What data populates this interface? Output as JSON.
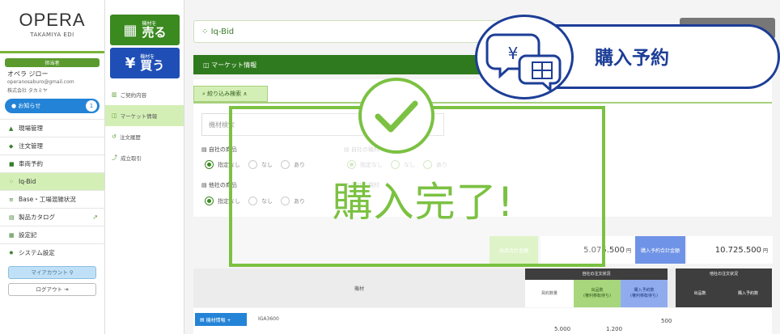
{
  "brand": {
    "name": "OPERA",
    "sub": "TAKAMIYA EDI"
  },
  "user": {
    "role": "担当者",
    "name": "オペラ ジロー",
    "email": "operanosaburo@gmail.com",
    "company": "株式会社 タカミヤ"
  },
  "notice": {
    "label": "● お知らせ",
    "count": "1"
  },
  "nav": [
    {
      "label": "現場管理"
    },
    {
      "label": "注文管理"
    },
    {
      "label": "車両予約"
    },
    {
      "label": "Iq-Bid"
    },
    {
      "label": "Base・工場混雑状況"
    },
    {
      "label": "製品カタログ"
    },
    {
      "label": "設定記"
    },
    {
      "label": "システム設定"
    }
  ],
  "account": {
    "myaccount": "マイアカウント",
    "logout": "ログアウト"
  },
  "trade": {
    "sell_small": "機材を",
    "sell_large": "売る",
    "buy_small": "機材を",
    "buy_large": "買う"
  },
  "sub_nav": [
    {
      "label": "ご契約内容"
    },
    {
      "label": "マーケット情報"
    },
    {
      "label": "注文履歴"
    },
    {
      "label": "成立取引"
    }
  ],
  "page": {
    "title": "Iq-Bid",
    "market_title": "マーケット情報"
  },
  "search": {
    "toggle_label": "絞り込み検索",
    "keyword_placeholder": "機材検索",
    "group1_label": "自社の商品",
    "group1_faded_label": "自社の機材",
    "group2_label": "他社の商品",
    "group2_faded_label": "他社の機材",
    "opt_none_specified": "指定なし",
    "opt_no": "なし",
    "opt_yes": "あり"
  },
  "summary": {
    "label1": "出品合計金額",
    "value1": "5.075.500",
    "label2": "購入予約合計金額",
    "value2": "10.725.500",
    "unit": "円"
  },
  "table": {
    "col_equipment": "機材",
    "group_own": "自社の注文状況",
    "group_other": "他社の注文状況",
    "col_contract_qty": "買約数量",
    "col_listing_qty": "出品数\n(権利移転待ち)",
    "col_reserve_qty": "購入予約数\n(権利移転待ち)",
    "col_listings": "出品数",
    "col_reservations": "購入予約数",
    "row": {
      "equip_btn": "機材情報 +",
      "model": "IGA3600",
      "contract_qty": "5.000",
      "listing_qty": "1.200",
      "reserve_qty": "500"
    }
  },
  "overlay": {
    "done_text": "購入完了!",
    "reservation_text": "購入予約"
  },
  "colors": {
    "green": "#3a8a1f",
    "light_green": "#7bc142",
    "blue": "#1d3e97",
    "accent_blue": "#2383d6"
  }
}
